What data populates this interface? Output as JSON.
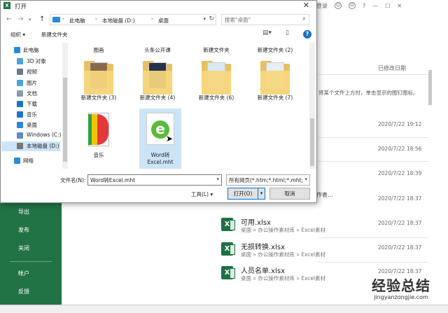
{
  "background": {
    "title_controls": [
      "登录"
    ],
    "column_header": "已修改日期",
    "info_text": "将某个文件上方时，单击显示的图钉图标。",
    "partial_item": "作表...",
    "nav": [
      "导出",
      "发布",
      "关闭",
      "帐户",
      "反馈"
    ],
    "dates": [
      "2020/7/22 19:12",
      "2020/7/22 18:56",
      "2020/7/22 18:39",
      "2020/7/22 18:37"
    ],
    "recent_files": [
      {
        "name": "可用.xlsx",
        "path": "桌面 » 办公操作素材库 » Excel素材",
        "date": "2020/7/22 18:37"
      },
      {
        "name": "无损转换.xlsx",
        "path": "桌面 » 办公操作素材库 » Excel素材",
        "date": "2020/7/22 18:37"
      },
      {
        "name": "人员名单.xlsx",
        "path": "桌面 » 办公操作素材库 » Excel素材",
        "date": "2020/7/22 18:37"
      }
    ],
    "watermark": {
      "big": "经验总结",
      "small": "jingyanzongjie.com"
    }
  },
  "dialog": {
    "title": "打开",
    "close_glyph": "✕",
    "breadcrumbs": [
      "此电脑",
      "本地磁盘 (D:)",
      "桌面"
    ],
    "search_placeholder": "搜索\"桌面\"",
    "toolbar": {
      "organize": "组织 ▾",
      "new_folder": "新建文件夹"
    },
    "sidebar": [
      {
        "label": "此电脑",
        "icon": "pc-icon",
        "color": "#2b8ad8"
      },
      {
        "label": "3D 对象",
        "icon": "3d-objects-icon",
        "color": "#4aa3df"
      },
      {
        "label": "视频",
        "icon": "video-icon",
        "color": "#6b7b8c"
      },
      {
        "label": "图片",
        "icon": "pictures-icon",
        "color": "#4aa3df"
      },
      {
        "label": "文档",
        "icon": "documents-icon",
        "color": "#8a9aa8"
      },
      {
        "label": "下载",
        "icon": "download-icon",
        "color": "#1a73c8"
      },
      {
        "label": "音乐",
        "icon": "music-icon",
        "color": "#1a73c8"
      },
      {
        "label": "桌面",
        "icon": "desktop-icon",
        "color": "#2b8ad8"
      },
      {
        "label": "Windows (C:)",
        "icon": "drive-c-icon",
        "color": "#5a8fc4"
      },
      {
        "label": "本地磁盘 (D:)",
        "icon": "drive-d-icon",
        "color": "#777777"
      },
      {
        "label": "网络",
        "icon": "network-icon",
        "color": "#2b8ad8"
      }
    ],
    "top_row_labels": [
      "图画",
      "头条公开课",
      "新建文件夹",
      "新建文件夹 (2)"
    ],
    "folder_row": [
      "新建文件夹 (3)",
      "新建文件夹 (4)",
      "新建文件夹 (6)",
      "新建文件夹 (7)"
    ],
    "music_label": "音乐",
    "selected_file": {
      "line1": "Word转",
      "line2": "Excel.mht"
    },
    "filename_label": "文件名(N):",
    "filename_value": "Word转Excel.mht",
    "filetype_value": "所有网页(*.htm;*.html;*.mht;*.m",
    "tools_label": "工具(L) ▾",
    "open_label": "打开(O)",
    "open_split": "▾",
    "cancel_label": "取消"
  }
}
